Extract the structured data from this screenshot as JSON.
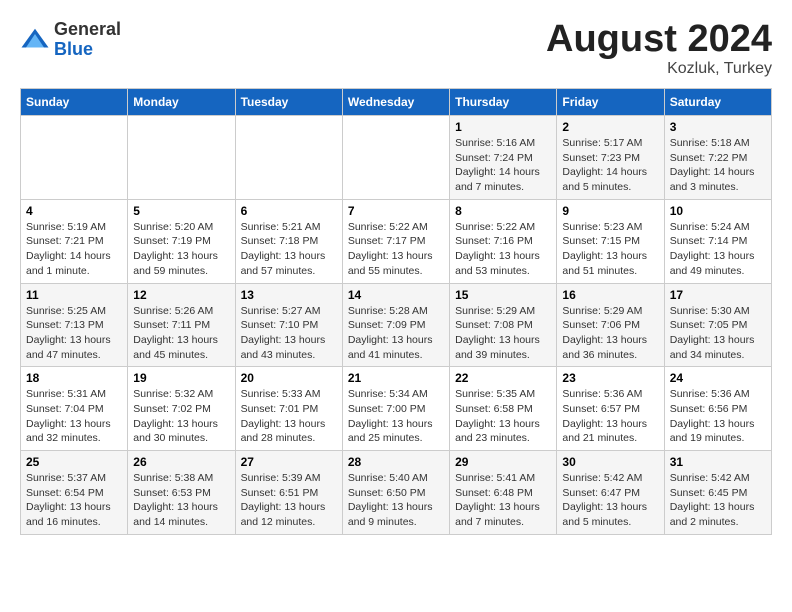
{
  "header": {
    "logo_general": "General",
    "logo_blue": "Blue",
    "month_title": "August 2024",
    "location": "Kozluk, Turkey"
  },
  "days_of_week": [
    "Sunday",
    "Monday",
    "Tuesday",
    "Wednesday",
    "Thursday",
    "Friday",
    "Saturday"
  ],
  "weeks": [
    {
      "days": [
        {
          "num": "",
          "info": ""
        },
        {
          "num": "",
          "info": ""
        },
        {
          "num": "",
          "info": ""
        },
        {
          "num": "",
          "info": ""
        },
        {
          "num": "1",
          "info": "Sunrise: 5:16 AM\nSunset: 7:24 PM\nDaylight: 14 hours\nand 7 minutes."
        },
        {
          "num": "2",
          "info": "Sunrise: 5:17 AM\nSunset: 7:23 PM\nDaylight: 14 hours\nand 5 minutes."
        },
        {
          "num": "3",
          "info": "Sunrise: 5:18 AM\nSunset: 7:22 PM\nDaylight: 14 hours\nand 3 minutes."
        }
      ]
    },
    {
      "days": [
        {
          "num": "4",
          "info": "Sunrise: 5:19 AM\nSunset: 7:21 PM\nDaylight: 14 hours\nand 1 minute."
        },
        {
          "num": "5",
          "info": "Sunrise: 5:20 AM\nSunset: 7:19 PM\nDaylight: 13 hours\nand 59 minutes."
        },
        {
          "num": "6",
          "info": "Sunrise: 5:21 AM\nSunset: 7:18 PM\nDaylight: 13 hours\nand 57 minutes."
        },
        {
          "num": "7",
          "info": "Sunrise: 5:22 AM\nSunset: 7:17 PM\nDaylight: 13 hours\nand 55 minutes."
        },
        {
          "num": "8",
          "info": "Sunrise: 5:22 AM\nSunset: 7:16 PM\nDaylight: 13 hours\nand 53 minutes."
        },
        {
          "num": "9",
          "info": "Sunrise: 5:23 AM\nSunset: 7:15 PM\nDaylight: 13 hours\nand 51 minutes."
        },
        {
          "num": "10",
          "info": "Sunrise: 5:24 AM\nSunset: 7:14 PM\nDaylight: 13 hours\nand 49 minutes."
        }
      ]
    },
    {
      "days": [
        {
          "num": "11",
          "info": "Sunrise: 5:25 AM\nSunset: 7:13 PM\nDaylight: 13 hours\nand 47 minutes."
        },
        {
          "num": "12",
          "info": "Sunrise: 5:26 AM\nSunset: 7:11 PM\nDaylight: 13 hours\nand 45 minutes."
        },
        {
          "num": "13",
          "info": "Sunrise: 5:27 AM\nSunset: 7:10 PM\nDaylight: 13 hours\nand 43 minutes."
        },
        {
          "num": "14",
          "info": "Sunrise: 5:28 AM\nSunset: 7:09 PM\nDaylight: 13 hours\nand 41 minutes."
        },
        {
          "num": "15",
          "info": "Sunrise: 5:29 AM\nSunset: 7:08 PM\nDaylight: 13 hours\nand 39 minutes."
        },
        {
          "num": "16",
          "info": "Sunrise: 5:29 AM\nSunset: 7:06 PM\nDaylight: 13 hours\nand 36 minutes."
        },
        {
          "num": "17",
          "info": "Sunrise: 5:30 AM\nSunset: 7:05 PM\nDaylight: 13 hours\nand 34 minutes."
        }
      ]
    },
    {
      "days": [
        {
          "num": "18",
          "info": "Sunrise: 5:31 AM\nSunset: 7:04 PM\nDaylight: 13 hours\nand 32 minutes."
        },
        {
          "num": "19",
          "info": "Sunrise: 5:32 AM\nSunset: 7:02 PM\nDaylight: 13 hours\nand 30 minutes."
        },
        {
          "num": "20",
          "info": "Sunrise: 5:33 AM\nSunset: 7:01 PM\nDaylight: 13 hours\nand 28 minutes."
        },
        {
          "num": "21",
          "info": "Sunrise: 5:34 AM\nSunset: 7:00 PM\nDaylight: 13 hours\nand 25 minutes."
        },
        {
          "num": "22",
          "info": "Sunrise: 5:35 AM\nSunset: 6:58 PM\nDaylight: 13 hours\nand 23 minutes."
        },
        {
          "num": "23",
          "info": "Sunrise: 5:36 AM\nSunset: 6:57 PM\nDaylight: 13 hours\nand 21 minutes."
        },
        {
          "num": "24",
          "info": "Sunrise: 5:36 AM\nSunset: 6:56 PM\nDaylight: 13 hours\nand 19 minutes."
        }
      ]
    },
    {
      "days": [
        {
          "num": "25",
          "info": "Sunrise: 5:37 AM\nSunset: 6:54 PM\nDaylight: 13 hours\nand 16 minutes."
        },
        {
          "num": "26",
          "info": "Sunrise: 5:38 AM\nSunset: 6:53 PM\nDaylight: 13 hours\nand 14 minutes."
        },
        {
          "num": "27",
          "info": "Sunrise: 5:39 AM\nSunset: 6:51 PM\nDaylight: 13 hours\nand 12 minutes."
        },
        {
          "num": "28",
          "info": "Sunrise: 5:40 AM\nSunset: 6:50 PM\nDaylight: 13 hours\nand 9 minutes."
        },
        {
          "num": "29",
          "info": "Sunrise: 5:41 AM\nSunset: 6:48 PM\nDaylight: 13 hours\nand 7 minutes."
        },
        {
          "num": "30",
          "info": "Sunrise: 5:42 AM\nSunset: 6:47 PM\nDaylight: 13 hours\nand 5 minutes."
        },
        {
          "num": "31",
          "info": "Sunrise: 5:42 AM\nSunset: 6:45 PM\nDaylight: 13 hours\nand 2 minutes."
        }
      ]
    }
  ]
}
